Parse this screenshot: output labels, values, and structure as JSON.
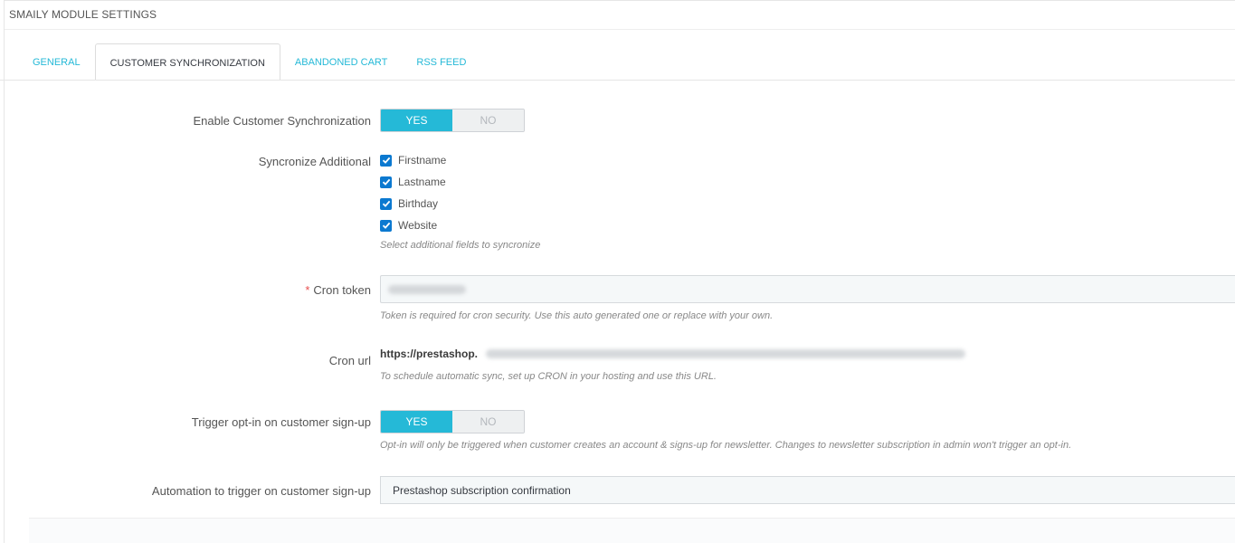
{
  "panel": {
    "title": "SMAILY MODULE SETTINGS"
  },
  "tabs": [
    {
      "label": "GENERAL"
    },
    {
      "label": "CUSTOMER SYNCHRONIZATION"
    },
    {
      "label": "ABANDONED CART"
    },
    {
      "label": "RSS FEED"
    }
  ],
  "form": {
    "enable_sync": {
      "label": "Enable Customer Synchronization",
      "yes": "YES",
      "no": "NO",
      "value": "YES"
    },
    "sync_additional": {
      "label": "Syncronize Additional",
      "options": [
        {
          "label": "Firstname",
          "checked": true
        },
        {
          "label": "Lastname",
          "checked": true
        },
        {
          "label": "Birthday",
          "checked": true
        },
        {
          "label": "Website",
          "checked": true
        }
      ],
      "help": "Select additional fields to syncronize"
    },
    "cron_token": {
      "required_mark": "*",
      "label": "Cron token",
      "help": "Token is required for cron security. Use this auto generated one or replace with your own."
    },
    "cron_url": {
      "label": "Cron url",
      "value": "https://prestashop.",
      "help": "To schedule automatic sync, set up CRON in your hosting and use this URL."
    },
    "trigger_optin": {
      "label": "Trigger opt-in on customer sign-up",
      "yes": "YES",
      "no": "NO",
      "value": "YES",
      "help": "Opt-in will only be triggered when customer creates an account & signs-up for newsletter. Changes to newsletter subscription in admin won't trigger an opt-in."
    },
    "automation": {
      "label": "Automation to trigger on customer sign-up",
      "selected": "Prestashop subscription confirmation"
    }
  },
  "colors": {
    "accent": "#25b9d7",
    "checkbox": "#0b79d0",
    "required": "#e84f4f"
  }
}
